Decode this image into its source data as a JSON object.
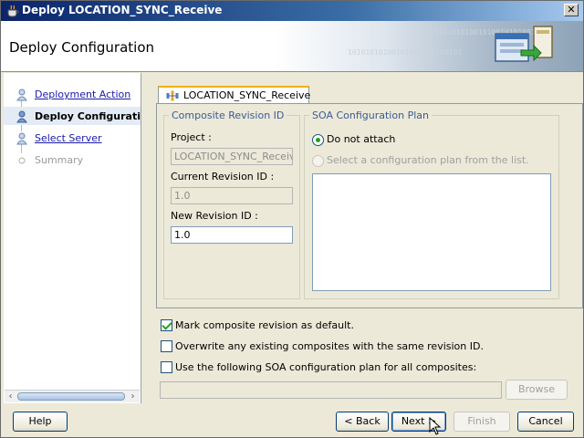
{
  "window": {
    "title": "Deploy LOCATION_SYNC_Receive",
    "close_symbol": "✕"
  },
  "banner": {
    "title": "Deploy Configuration",
    "binary_text": "10101010100101001010100101"
  },
  "nav": {
    "steps": [
      {
        "label": "Deployment Action",
        "state": "link"
      },
      {
        "label": "Deploy Configuration",
        "state": "current"
      },
      {
        "label": "Select Server",
        "state": "link"
      },
      {
        "label": "Summary",
        "state": "disabled"
      }
    ]
  },
  "tab": {
    "label": "LOCATION_SYNC_Receive"
  },
  "composite_revision": {
    "legend": "Composite Revision ID",
    "project_label": "Project :",
    "project_value": "LOCATION_SYNC_Receive",
    "current_label": "Current Revision ID :",
    "current_value": "1.0",
    "new_label": "New Revision ID :",
    "new_value": "1.0"
  },
  "soa_plan": {
    "legend": "SOA Configuration Plan",
    "option_none": "Do not attach",
    "option_select": "Select a configuration plan from the list.",
    "selected": "none"
  },
  "options": {
    "mark_default": {
      "label": "Mark composite revision as default.",
      "checked": true
    },
    "overwrite": {
      "label": "Overwrite any existing composites with the same revision ID.",
      "checked": false
    },
    "use_plan": {
      "label": "Use the following SOA configuration plan for all composites:",
      "checked": false
    },
    "browse_label": "Browse"
  },
  "buttons": {
    "help": "Help",
    "back": "< Back",
    "next": "Next >",
    "finish": "Finish",
    "cancel": "Cancel"
  },
  "colors": {
    "accent": "#0a246a",
    "link": "#1a1aa8",
    "legend": "#3a5b96",
    "tab_highlight": "#f0b000"
  }
}
